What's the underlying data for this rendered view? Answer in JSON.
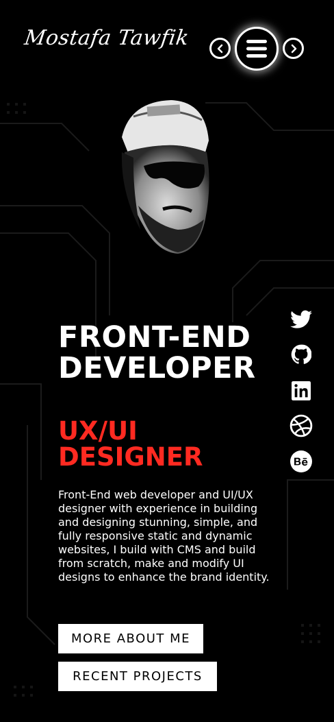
{
  "header": {
    "logo_text": "Mostafa Tawfik"
  },
  "hero": {
    "headline_line1": "FRONT-END",
    "headline_line2": "DEVELOPER",
    "subhead_line1": "UX/UI",
    "subhead_line2": "DESIGNER",
    "description": "Front-End web developer and UI/UX designer with experience in building and designing stunning, simple, and fully responsive static and dynamic websites, I build with CMS and build from scratch, make and modify UI designs to enhance the brand identity.",
    "button_about": "MORE ABOUT ME",
    "button_projects": "RECENT PROJECTS"
  },
  "colors": {
    "background": "#000000",
    "accent": "#ff2a21",
    "text": "#ffffff"
  },
  "icons": [
    "chevron-left-icon",
    "hamburger-menu-icon",
    "chevron-right-icon",
    "twitter-icon",
    "github-icon",
    "linkedin-icon",
    "dribbble-icon",
    "behance-icon"
  ]
}
